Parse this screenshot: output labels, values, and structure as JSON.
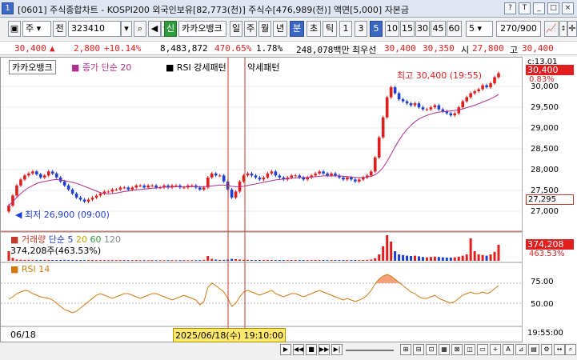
{
  "window": {
    "badge": "1",
    "title": "[0601] 주식종합차트 - KOSPI200 외국인보유[82,773(천)] 주식수[476,989(천)] 액면[5,000] 자본금",
    "buttons": [
      "?",
      "T",
      "_",
      "□",
      "×"
    ]
  },
  "toolbar": {
    "code_type": "주",
    "prev_label": "전",
    "code": "323410",
    "new_badge": "신",
    "stock_name": "카카오뱅크",
    "periods": [
      "일",
      "주",
      "월",
      "년",
      "분",
      "초",
      "틱"
    ],
    "selected_period": "분",
    "intervals": [
      "1",
      "3",
      "5",
      "10",
      "15",
      "30",
      "45",
      "60"
    ],
    "selected_interval": "5",
    "count_value": "5",
    "range_value": "270/900",
    "right_icons": [
      "📈",
      "↕",
      "✛"
    ]
  },
  "quote": {
    "price": "30,400",
    "arrow": "▲",
    "change": "2,800",
    "change_rate": "+10.14%",
    "volume": "8,483,872",
    "volume_ratio": "470.65%",
    "turnover": "1.78%",
    "amount": "248,078백만",
    "best_label": "최우선",
    "ask": "30,400",
    "bid": "30,350",
    "open_label": "시",
    "open": "27,800",
    "high_label": "고",
    "high": "30,400"
  },
  "price_panel": {
    "legend_name": "카카오뱅크",
    "legend_ma": "종가 단순 20",
    "legend_pattern_a": "RSI 강세패턴",
    "legend_pattern_b": "약세패턴",
    "high_note": "최고 30,400 (19:55)",
    "low_note": "최저 26,900 (09:00)",
    "side_top": "c:13.01",
    "side_price": "30,400",
    "side_pct": "0.83%",
    "side_ref": "27,295"
  },
  "volume_panel": {
    "legend_title": "거래량",
    "legend_ma": "단순",
    "ma_periods": [
      "5",
      "20",
      "60",
      "120"
    ],
    "value_text": "374,208주(463.53%)",
    "side_value": "374,208",
    "side_pct": "463.53%"
  },
  "rsi_panel": {
    "legend": "RSI 14"
  },
  "axis": {
    "date_left": "06/18",
    "cursor_date": "2025/06/18(수) 19:10:00",
    "time_right": "19:55:00",
    "price_ticks": [
      "30,000",
      "29,500",
      "29,000",
      "28,500",
      "28,000",
      "27,500",
      "27,000"
    ],
    "rsi_ticks": [
      "75.00",
      "50.00"
    ]
  },
  "chart_data": {
    "type": "line",
    "title": "",
    "y_range": [
      26800,
      30550
    ],
    "close": [
      27100,
      27350,
      27600,
      27750,
      27850,
      27900,
      27950,
      27880,
      27800,
      27850,
      27950,
      27900,
      27800,
      27700,
      27600,
      27500,
      27400,
      27300,
      27250,
      27200,
      27250,
      27300,
      27350,
      27400,
      27450,
      27450,
      27500,
      27500,
      27550,
      27550,
      27500,
      27550,
      27600,
      27600,
      27550,
      27600,
      27600,
      27550,
      27550,
      27600,
      27550,
      27600,
      27600,
      27550,
      27550,
      27600,
      27600,
      27550,
      27500,
      27550,
      27800,
      27900,
      27850,
      27850,
      27700,
      27500,
      27300,
      27450,
      27700,
      27850,
      27900,
      27850,
      27800,
      27750,
      27800,
      27900,
      27950,
      27850,
      27800,
      27750,
      27800,
      27850,
      27850,
      27800,
      27750,
      27800,
      27850,
      27900,
      27950,
      27900,
      27850,
      27900,
      27850,
      27800,
      27750,
      27800,
      27750,
      27700,
      27750,
      27800,
      27850,
      27950,
      28300,
      28800,
      29300,
      29800,
      30050,
      29900,
      29750,
      29700,
      29650,
      29600,
      29650,
      29550,
      29500,
      29500,
      29550,
      29600,
      29500,
      29450,
      29400,
      29350,
      29400,
      29550,
      29700,
      29800,
      29900,
      29950,
      30000,
      30100,
      30050,
      30150,
      30300,
      30400
    ],
    "ma20": [
      27100,
      27200,
      27300,
      27400,
      27480,
      27550,
      27600,
      27650,
      27680,
      27700,
      27720,
      27740,
      27750,
      27740,
      27720,
      27700,
      27680,
      27650,
      27620,
      27580,
      27540,
      27500,
      27460,
      27420,
      27400,
      27390,
      27400,
      27410,
      27430,
      27450,
      27460,
      27480,
      27490,
      27500,
      27510,
      27520,
      27530,
      27540,
      27550,
      27560,
      27560,
      27560,
      27570,
      27570,
      27570,
      27570,
      27570,
      27570,
      27570,
      27570,
      27580,
      27590,
      27600,
      27610,
      27610,
      27600,
      27580,
      27570,
      27570,
      27580,
      27600,
      27620,
      27640,
      27660,
      27680,
      27700,
      27720,
      27740,
      27750,
      27760,
      27770,
      27780,
      27790,
      27800,
      27800,
      27800,
      27810,
      27820,
      27830,
      27840,
      27840,
      27840,
      27840,
      27840,
      27830,
      27820,
      27810,
      27800,
      27800,
      27800,
      27810,
      27830,
      27870,
      27940,
      28050,
      28200,
      28380,
      28560,
      28730,
      28880,
      29000,
      29100,
      29190,
      29260,
      29310,
      29350,
      29380,
      29410,
      29430,
      29440,
      29450,
      29460,
      29470,
      29490,
      29510,
      29540,
      29570,
      29600,
      29640,
      29680,
      29720,
      29760,
      29810,
      29870
    ],
    "rsi": [
      55,
      58,
      62,
      64,
      66,
      65,
      62,
      60,
      58,
      57,
      56,
      54,
      50,
      46,
      42,
      40,
      38,
      40,
      44,
      48,
      52,
      56,
      60,
      62,
      60,
      58,
      56,
      58,
      60,
      62,
      62,
      60,
      58,
      56,
      58,
      60,
      62,
      62,
      60,
      58,
      56,
      54,
      56,
      58,
      60,
      58,
      56,
      54,
      48,
      52,
      70,
      75,
      72,
      68,
      64,
      56,
      46,
      50,
      58,
      64,
      66,
      64,
      62,
      60,
      62,
      64,
      66,
      62,
      60,
      58,
      60,
      62,
      62,
      60,
      58,
      60,
      62,
      64,
      66,
      64,
      62,
      60,
      58,
      56,
      54,
      56,
      54,
      52,
      54,
      56,
      60,
      66,
      74,
      80,
      84,
      86,
      84,
      80,
      76,
      72,
      68,
      64,
      62,
      58,
      56,
      56,
      58,
      60,
      56,
      54,
      52,
      50,
      52,
      56,
      60,
      62,
      64,
      62,
      62,
      64,
      62,
      64,
      68,
      72
    ],
    "volume": [
      300,
      90,
      40,
      35,
      30,
      30,
      28,
      26,
      28,
      30,
      28,
      26,
      26,
      28,
      30,
      26,
      24,
      22,
      22,
      24,
      24,
      22,
      20,
      20,
      20,
      20,
      22,
      20,
      20,
      22,
      20,
      20,
      20,
      20,
      20,
      20,
      20,
      20,
      20,
      20,
      20,
      20,
      20,
      20,
      20,
      20,
      20,
      20,
      24,
      30,
      150,
      60,
      40,
      30,
      30,
      40,
      60,
      50,
      40,
      30,
      30,
      26,
      24,
      24,
      26,
      28,
      28,
      26,
      24,
      24,
      24,
      26,
      26,
      24,
      24,
      24,
      26,
      26,
      26,
      26,
      24,
      24,
      24,
      24,
      24,
      24,
      24,
      24,
      24,
      26,
      30,
      40,
      80,
      200,
      450,
      800,
      600,
      300,
      200,
      180,
      160,
      150,
      160,
      140,
      120,
      110,
      120,
      130,
      120,
      110,
      100,
      100,
      110,
      130,
      160,
      200,
      700,
      300,
      200,
      180,
      160,
      200,
      280,
      500
    ]
  }
}
